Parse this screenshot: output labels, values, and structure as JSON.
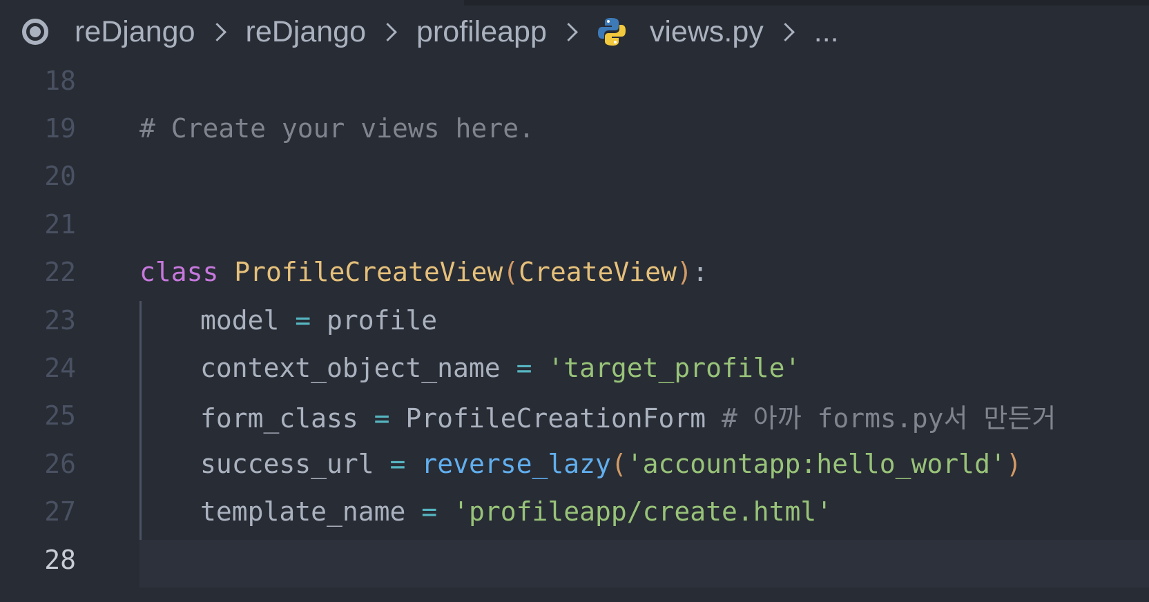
{
  "breadcrumb": {
    "items": [
      "reDjango",
      "reDjango",
      "profileapp",
      "views.py",
      "..."
    ]
  },
  "editor": {
    "lines": [
      {
        "number": "18",
        "tokens": []
      },
      {
        "number": "19",
        "tokens": [
          {
            "t": "# Create your views here.",
            "c": "comment"
          }
        ]
      },
      {
        "number": "20",
        "tokens": []
      },
      {
        "number": "21",
        "tokens": []
      },
      {
        "number": "22",
        "tokens": [
          {
            "t": "class",
            "c": "keyword"
          },
          {
            "t": " ",
            "c": "plain"
          },
          {
            "t": "ProfileCreateView",
            "c": "class"
          },
          {
            "t": "(",
            "c": "paren"
          },
          {
            "t": "CreateView",
            "c": "class"
          },
          {
            "t": ")",
            "c": "paren"
          },
          {
            "t": ":",
            "c": "plain"
          }
        ]
      },
      {
        "number": "23",
        "tokens": [
          {
            "t": "model",
            "c": "plain"
          },
          {
            "t": " = ",
            "c": "op"
          },
          {
            "t": "profile",
            "c": "plain"
          }
        ]
      },
      {
        "number": "24",
        "tokens": [
          {
            "t": "context_object_name",
            "c": "plain"
          },
          {
            "t": " = ",
            "c": "op"
          },
          {
            "t": "'target_profile'",
            "c": "string"
          }
        ]
      },
      {
        "number": "25",
        "tokens": [
          {
            "t": "form_class",
            "c": "plain"
          },
          {
            "t": " = ",
            "c": "op"
          },
          {
            "t": "ProfileCreationForm",
            "c": "plain"
          },
          {
            "t": " # 아까 forms.py서 만든거",
            "c": "comment"
          }
        ]
      },
      {
        "number": "26",
        "tokens": [
          {
            "t": "success_url",
            "c": "plain"
          },
          {
            "t": " = ",
            "c": "op"
          },
          {
            "t": "reverse_lazy",
            "c": "func"
          },
          {
            "t": "(",
            "c": "paren"
          },
          {
            "t": "'accountapp:hello_world'",
            "c": "string"
          },
          {
            "t": ")",
            "c": "paren"
          }
        ]
      },
      {
        "number": "27",
        "tokens": [
          {
            "t": "template_name",
            "c": "plain"
          },
          {
            "t": " = ",
            "c": "op"
          },
          {
            "t": "'profileapp/create.html'",
            "c": "string"
          }
        ]
      },
      {
        "number": "28",
        "tokens": []
      }
    ],
    "active_line": "28"
  },
  "colors": {
    "background": "#282c34",
    "comment": "#7f848e",
    "keyword": "#c678dd",
    "class": "#e5c07b",
    "string": "#98c379",
    "function": "#61afef",
    "operator": "#56b6c2"
  },
  "icons": {
    "root": "circle-dot-icon",
    "file": "python-icon"
  }
}
